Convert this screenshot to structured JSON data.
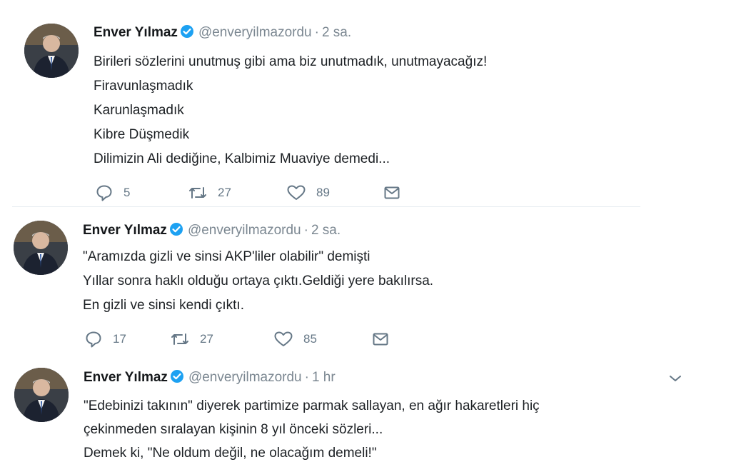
{
  "tweets": [
    {
      "name": "Enver Yılmaz",
      "handle": "@enveryilmazordu",
      "separator": "·",
      "time": "2 sa.",
      "lines": [
        "Birileri sözlerini unutmuş gibi ama biz unutmadık, unutmayacağız!",
        "Firavunlaşmadık",
        "Karunlaşmadık",
        "Kibre Düşmedik",
        "Dilimizin Ali dediğine, Kalbimiz Muaviye demedi..."
      ],
      "replies": "5",
      "retweets": "27",
      "likes": "89"
    },
    {
      "name": "Enver Yılmaz",
      "handle": "@enveryilmazordu",
      "separator": "·",
      "time": "2 sa.",
      "lines": [
        "\"Aramızda gizli ve sinsi AKP'liler olabilir\" demişti",
        "Yıllar sonra haklı olduğu ortaya çıktı.Geldiği yere bakılırsa.",
        "En gizli ve sinsi kendi çıktı."
      ],
      "replies": "17",
      "retweets": "27",
      "likes": "85"
    },
    {
      "name": "Enver Yılmaz",
      "handle": "@enveryilmazordu",
      "separator": "·",
      "time": "1 hr",
      "lines": [
        "\"Edebinizi takının\" diyerek partimize parmak sallayan, en ağır hakaretleri hiç",
        "çekinmeden sıralayan kişinin 8 yıl önceki sözleri...",
        "Demek ki, \"Ne oldum değil, ne olacağım demeli!\""
      ]
    }
  ],
  "icons": {
    "reply": "reply-icon",
    "retweet": "retweet-icon",
    "like": "heart-icon",
    "dm": "envelope-icon",
    "caret": "chevron-down-icon",
    "verified": "verified-badge-icon"
  },
  "colors": {
    "verified_blue": "#1da1f2",
    "muted": "#657786",
    "text": "#14171a"
  }
}
